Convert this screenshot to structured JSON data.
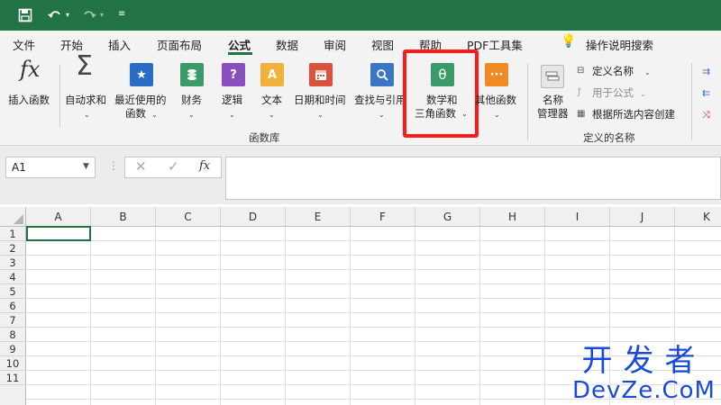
{
  "quick_access": {
    "save_icon": "save-icon",
    "undo_icon": "undo-icon",
    "redo_icon": "redo-icon",
    "customize_icon": "customize-qat-icon"
  },
  "tabs": [
    {
      "label": "文件"
    },
    {
      "label": "开始"
    },
    {
      "label": "插入"
    },
    {
      "label": "页面布局"
    },
    {
      "label": "公式",
      "active": true
    },
    {
      "label": "数据"
    },
    {
      "label": "审阅"
    },
    {
      "label": "视图"
    },
    {
      "label": "帮助"
    },
    {
      "label": "PDF工具集"
    },
    {
      "label": "操作说明搜索"
    }
  ],
  "ribbon": {
    "insert_function": {
      "icon_text": "fx",
      "label": "插入函数"
    },
    "autosum": {
      "icon_text": "Σ",
      "label": "自动求和"
    },
    "recent": {
      "icon_text": "★",
      "line1": "最近使用的",
      "line2": "函数"
    },
    "financial": {
      "label": "财务"
    },
    "logical": {
      "icon_text": "?",
      "label": "逻辑"
    },
    "text": {
      "icon_text": "A",
      "label": "文本"
    },
    "datetime": {
      "label": "日期和时间"
    },
    "lookup": {
      "label": "查找与引用"
    },
    "math": {
      "icon_text": "θ",
      "line1": "数学和",
      "line2": "三角函数"
    },
    "more": {
      "icon_text": "···",
      "label": "其他函数"
    },
    "group_function_library": "函数库",
    "name_manager": {
      "line1": "名称",
      "line2": "管理器"
    },
    "define_name": "定义名称",
    "use_in_formula": "用于公式",
    "create_from_selection": "根据所选内容创建",
    "group_defined_names": "定义的名称",
    "accent_color": "#217346",
    "highlight_color": "#ff1a1a"
  },
  "formula_bar": {
    "name_box": "A1",
    "fx_label": "fx",
    "formula": ""
  },
  "grid": {
    "columns": [
      "A",
      "B",
      "C",
      "D",
      "E",
      "F",
      "G",
      "H",
      "I",
      "J",
      "K"
    ],
    "rows": [
      "1",
      "2",
      "3",
      "4",
      "5",
      "6",
      "7",
      "8",
      "9",
      "10",
      "11"
    ]
  },
  "watermark": {
    "line1": "开发者",
    "line2": "DevZe.CoM"
  }
}
